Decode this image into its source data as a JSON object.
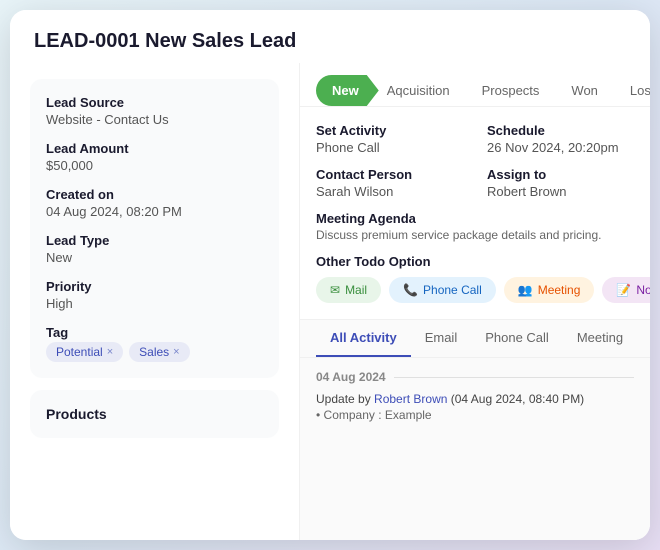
{
  "header": {
    "title": "LEAD-0001 New Sales Lead"
  },
  "left_panel": {
    "info_card": {
      "fields": [
        {
          "label": "Lead Source",
          "value": "Website - Contact Us"
        },
        {
          "label": "Lead Amount",
          "value": "$50,000"
        },
        {
          "label": "Created on",
          "value": "04 Aug 2024, 08:20 PM"
        },
        {
          "label": "Lead Type",
          "value": "New"
        },
        {
          "label": "Priority",
          "value": "High"
        },
        {
          "label": "Tag",
          "value": null
        }
      ],
      "tags": [
        "Potential",
        "Sales"
      ]
    },
    "products_label": "Products"
  },
  "pipeline": {
    "tabs": [
      {
        "label": "New",
        "active": true
      },
      {
        "label": "Aqcuisition",
        "active": false
      },
      {
        "label": "Prospects",
        "active": false
      },
      {
        "label": "Won",
        "active": false
      },
      {
        "label": "Lost",
        "active": false
      }
    ]
  },
  "activity_section": {
    "set_activity_label": "Set Activity",
    "set_activity_value": "Phone Call",
    "schedule_label": "Schedule",
    "schedule_value": "26 Nov 2024, 20:20pm",
    "contact_person_label": "Contact Person",
    "contact_person_value": "Sarah Wilson",
    "assign_to_label": "Assign to",
    "assign_to_value": "Robert Brown",
    "meeting_agenda_label": "Meeting Agenda",
    "meeting_agenda_text": "Discuss premium service package details and pricing.",
    "other_todo_label": "Other Todo Option",
    "todo_buttons": [
      {
        "label": "Mail",
        "icon": "✉",
        "type": "mail"
      },
      {
        "label": "Phone Call",
        "icon": "📞",
        "type": "phone"
      },
      {
        "label": "Meeting",
        "icon": "👥",
        "type": "meeting"
      },
      {
        "label": "Note",
        "icon": "📝",
        "type": "note"
      }
    ]
  },
  "log_tabs": [
    {
      "label": "All Activity",
      "active": true
    },
    {
      "label": "Email",
      "active": false
    },
    {
      "label": "Phone Call",
      "active": false
    },
    {
      "label": "Meeting",
      "active": false
    }
  ],
  "log_entries": [
    {
      "date": "04 Aug 2024",
      "update_line": "Update by Robert Brown (04 Aug 2024, 08:40 PM)",
      "company_line": "• Company : Example",
      "link_text": "Robert Brown"
    }
  ]
}
